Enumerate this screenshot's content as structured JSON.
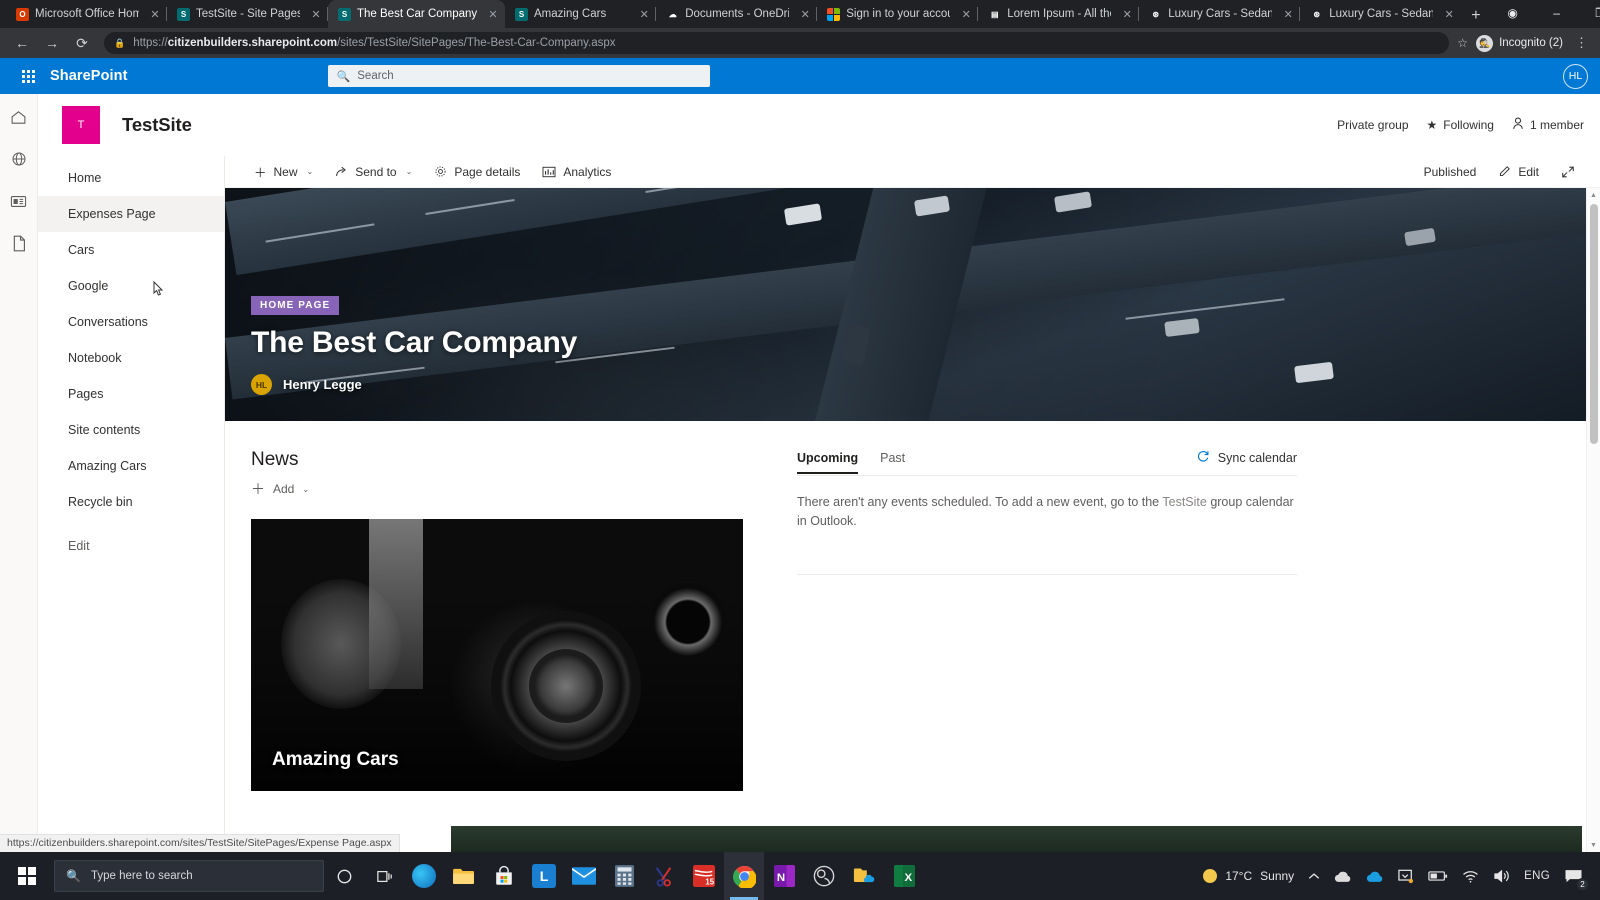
{
  "browser": {
    "tabs": [
      {
        "title": "Microsoft Office Home",
        "favicon": "office-icon",
        "active": false
      },
      {
        "title": "TestSite - Site Pages -",
        "favicon": "sharepoint-icon",
        "active": false
      },
      {
        "title": "The Best Car Company",
        "favicon": "sharepoint-icon",
        "active": true
      },
      {
        "title": "Amazing Cars",
        "favicon": "sharepoint-icon",
        "active": false
      },
      {
        "title": "Documents - OneDriv",
        "favicon": "onedrive-icon",
        "active": false
      },
      {
        "title": "Sign in to your accoun",
        "favicon": "microsoft-icon",
        "active": false
      },
      {
        "title": "Lorem Ipsum - All the",
        "favicon": "document-icon",
        "active": false
      },
      {
        "title": "Luxury Cars - Sedans,",
        "favicon": "mercedes-icon",
        "active": false
      },
      {
        "title": "Luxury Cars - Sedans,",
        "favicon": "mercedes-icon",
        "active": false
      }
    ],
    "new_tab_label": "+",
    "close_label": "✕",
    "window_controls": {
      "minimize": "–",
      "maximize": "❐",
      "close": "✕",
      "profile_dot": "◉"
    },
    "nav": {
      "back": "←",
      "forward": "→",
      "reload": "⟳"
    },
    "url": {
      "scheme": "https://",
      "domain": "citizenbuilders.sharepoint.com",
      "path": "/sites/TestSite/SitePages/The-Best-Car-Company.aspx",
      "lock_icon": "lock-icon"
    },
    "star_icon": "☆",
    "incognito_label": "Incognito (2)",
    "menu_icon": "⋮",
    "status_url": "https://citizenbuilders.sharepoint.com/sites/TestSite/SitePages/Expense Page.aspx"
  },
  "suitebar": {
    "waffle_icon": "app-launcher-icon",
    "brand": "SharePoint",
    "search": {
      "placeholder": "Search",
      "icon": "search-icon"
    },
    "avatar_initials": "HL"
  },
  "rail": {
    "items": [
      {
        "icon": "home-icon",
        "name": "home"
      },
      {
        "icon": "globe-icon",
        "name": "global-navigation"
      },
      {
        "icon": "news-icon",
        "name": "news"
      },
      {
        "icon": "document-icon",
        "name": "documents"
      }
    ]
  },
  "site": {
    "logo_letter": "T",
    "logo_color": "#e3008c",
    "title": "TestSite",
    "privacy": "Private group",
    "following": "Following",
    "following_icon": "star-icon",
    "members": "1 member",
    "members_icon": "person-icon"
  },
  "nav": {
    "items": [
      {
        "label": "Home",
        "selected": false
      },
      {
        "label": "Expenses Page",
        "selected": true
      },
      {
        "label": "Cars",
        "selected": false
      },
      {
        "label": "Google",
        "selected": false
      },
      {
        "label": "Conversations",
        "selected": false
      },
      {
        "label": "Notebook",
        "selected": false
      },
      {
        "label": "Pages",
        "selected": false
      },
      {
        "label": "Site contents",
        "selected": false
      },
      {
        "label": "Amazing Cars",
        "selected": false
      },
      {
        "label": "Recycle bin",
        "selected": false
      }
    ],
    "edit_label": "Edit"
  },
  "commandbar": {
    "new_label": "New",
    "new_icon": "plus-icon",
    "send_to_label": "Send to",
    "send_to_icon": "share-icon",
    "page_details_label": "Page details",
    "page_details_icon": "gear-icon",
    "analytics_label": "Analytics",
    "analytics_icon": "analytics-icon",
    "chevron": "⌄",
    "published_label": "Published",
    "edit_label": "Edit",
    "edit_icon": "pencil-icon",
    "expand_icon": "expand-icon"
  },
  "hero": {
    "badge": "HOME PAGE",
    "title": "The Best Car Company",
    "author_initials": "HL",
    "author_name": "Henry Legge",
    "badge_color": "#8764b8"
  },
  "news": {
    "title": "News",
    "add_label": "Add",
    "add_icon": "plus-icon",
    "chevron": "⌄",
    "card_title": "Amazing Cars"
  },
  "events": {
    "tabs": [
      {
        "label": "Upcoming",
        "active": true
      },
      {
        "label": "Past",
        "active": false
      }
    ],
    "sync_label": "Sync calendar",
    "sync_icon": "refresh-icon",
    "empty_text_before": "There aren't any events scheduled. To add a new event, go to the ",
    "empty_link": "TestSite",
    "empty_text_after": " group calendar in Outlook."
  },
  "taskbar": {
    "start_icon": "windows-icon",
    "search_placeholder": "Type here to search",
    "search_icon": "search-icon",
    "cortana_icon": "cortana-icon",
    "taskview_icon": "task-view-icon",
    "apps": [
      {
        "name": "edge-icon",
        "label": "",
        "color": "#1b8dd6",
        "active": false
      },
      {
        "name": "file-explorer-icon",
        "label": "",
        "color": "#ffc24b",
        "active": false
      },
      {
        "name": "microsoft-store-icon",
        "label": "",
        "color": "#f3f3f3",
        "active": false
      },
      {
        "name": "linkedin-icon",
        "label": "L",
        "color": "#0a66c2",
        "active": false
      },
      {
        "name": "mail-icon",
        "label": "",
        "color": "#1b8dd6",
        "active": false
      },
      {
        "name": "calculator-icon",
        "label": "",
        "color": "#5b7289",
        "active": false
      },
      {
        "name": "snip-tool-icon",
        "label": "",
        "color": "#2b3a8f",
        "active": false
      },
      {
        "name": "adobe-icon",
        "label": "15",
        "color": "#d92f26",
        "active": false
      },
      {
        "name": "chrome-icon",
        "label": "",
        "color": "#4285f4",
        "active": true
      },
      {
        "name": "onenote-icon",
        "label": "N",
        "color": "#7719aa",
        "active": false
      },
      {
        "name": "obs-icon",
        "label": "",
        "color": "#3b3b3b",
        "active": false
      },
      {
        "name": "onedrive-folder-icon",
        "label": "",
        "color": "#ffc24b",
        "active": false
      },
      {
        "name": "excel-icon",
        "label": "X",
        "color": "#107c41",
        "active": false
      }
    ],
    "tray": {
      "weather_temp": "17°C",
      "weather_desc": "Sunny",
      "weather_icon": "sun-icon",
      "overflow_icon": "chevron-up-icon",
      "onedrive_gray_icon": "cloud-icon",
      "onedrive_blue_icon": "cloud-icon",
      "screenshot_icon": "screen-icon",
      "battery_icon": "battery-icon",
      "wifi_icon": "wifi-icon",
      "volume_icon": "speaker-icon",
      "language": "ENG",
      "notification_icon": "notification-icon",
      "notification_count": "2"
    }
  }
}
